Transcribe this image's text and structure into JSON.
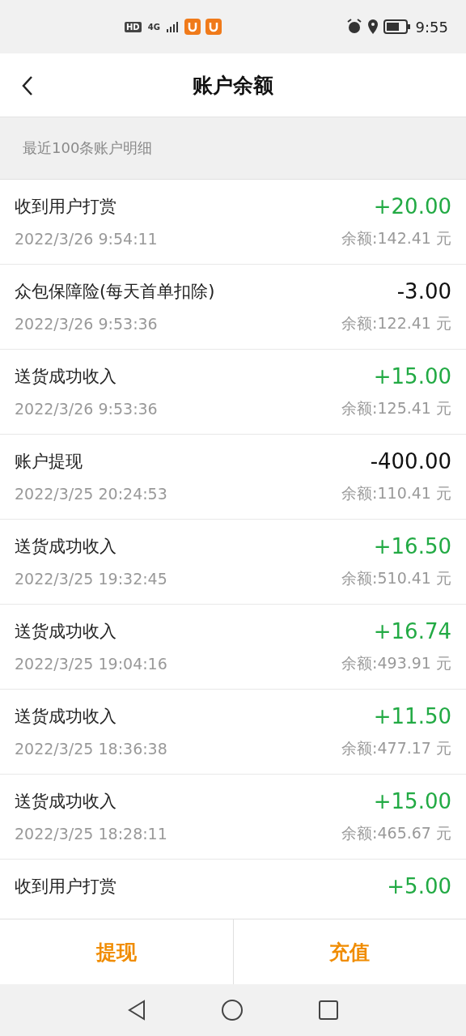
{
  "status_bar": {
    "badges": [
      "HD",
      "4G"
    ],
    "time": "9:55"
  },
  "header": {
    "title": "账户余额"
  },
  "section": {
    "label": "最近100条账户明细"
  },
  "transactions": [
    {
      "title": "收到用户打赏",
      "amount": "+20.00",
      "kind": "income",
      "time": "2022/3/26 9:54:11",
      "balance": "余额:142.41 元"
    },
    {
      "title": "众包保障险(每天首单扣除)",
      "amount": "-3.00",
      "kind": "expense",
      "time": "2022/3/26 9:53:36",
      "balance": "余额:122.41 元"
    },
    {
      "title": "送货成功收入",
      "amount": "+15.00",
      "kind": "income",
      "time": "2022/3/26 9:53:36",
      "balance": "余额:125.41 元"
    },
    {
      "title": "账户提现",
      "amount": "-400.00",
      "kind": "expense",
      "time": "2022/3/25 20:24:53",
      "balance": "余额:110.41 元"
    },
    {
      "title": "送货成功收入",
      "amount": "+16.50",
      "kind": "income",
      "time": "2022/3/25 19:32:45",
      "balance": "余额:510.41 元"
    },
    {
      "title": "送货成功收入",
      "amount": "+16.74",
      "kind": "income",
      "time": "2022/3/25 19:04:16",
      "balance": "余额:493.91 元"
    },
    {
      "title": "送货成功收入",
      "amount": "+11.50",
      "kind": "income",
      "time": "2022/3/25 18:36:38",
      "balance": "余额:477.17 元"
    },
    {
      "title": "送货成功收入",
      "amount": "+15.00",
      "kind": "income",
      "time": "2022/3/25 18:28:11",
      "balance": "余额:465.67 元"
    },
    {
      "title": "收到用户打赏",
      "amount": "+5.00",
      "kind": "income"
    }
  ],
  "actions": [
    "提现",
    "充值"
  ]
}
